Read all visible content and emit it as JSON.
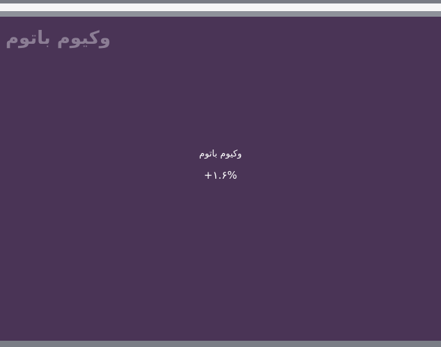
{
  "watermark": {
    "text": "وکیوم باتوم"
  },
  "tile": {
    "label": "وکیوم باتوم",
    "change": "+۱.۶%"
  },
  "colors": {
    "panel_background": "#4a3456",
    "watermark_text": "#8b7d94",
    "tile_text": "#ffffff",
    "frame_gray": "#7a7d86",
    "white_bar": "#f7f7f8"
  }
}
